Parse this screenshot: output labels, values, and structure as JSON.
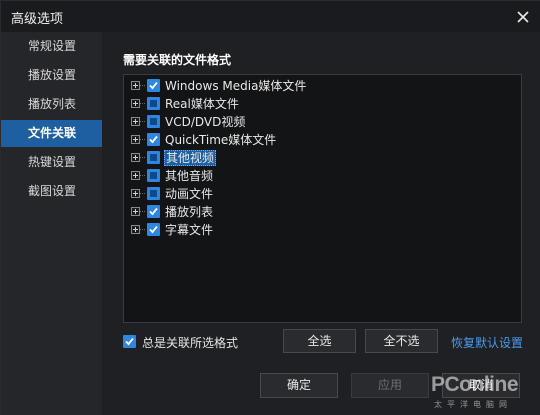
{
  "window": {
    "title": "高级选项"
  },
  "sidebar": {
    "items": [
      {
        "label": "常规设置",
        "active": false
      },
      {
        "label": "播放设置",
        "active": false
      },
      {
        "label": "播放列表",
        "active": false
      },
      {
        "label": "文件关联",
        "active": true
      },
      {
        "label": "热键设置",
        "active": false
      },
      {
        "label": "截图设置",
        "active": false
      }
    ]
  },
  "main": {
    "section_title": "需要关联的文件格式",
    "file_types": [
      {
        "label": "Windows Media媒体文件",
        "state": "checked",
        "selected": false
      },
      {
        "label": "Real媒体文件",
        "state": "partial",
        "selected": false
      },
      {
        "label": "VCD/DVD视频",
        "state": "partial",
        "selected": false
      },
      {
        "label": "QuickTime媒体文件",
        "state": "checked",
        "selected": false
      },
      {
        "label": "其他视频",
        "state": "partial",
        "selected": true
      },
      {
        "label": "其他音频",
        "state": "partial",
        "selected": false
      },
      {
        "label": "动画文件",
        "state": "partial",
        "selected": false
      },
      {
        "label": "播放列表",
        "state": "checked",
        "selected": false
      },
      {
        "label": "字幕文件",
        "state": "checked",
        "selected": false
      }
    ],
    "always_associate": {
      "label": "总是关联所选格式",
      "checked": true
    },
    "select_all_label": "全选",
    "select_none_label": "全不选",
    "restore_defaults_label": "恢复默认设置"
  },
  "footer": {
    "ok_label": "确定",
    "apply_label": "应用",
    "cancel_label": "取消"
  },
  "watermark": {
    "brand": "PConline",
    "sub": "太平洋电脑网"
  },
  "colors": {
    "accent": "#2e86e0",
    "active_nav": "#1d5fa0",
    "link": "#4a9bef"
  }
}
